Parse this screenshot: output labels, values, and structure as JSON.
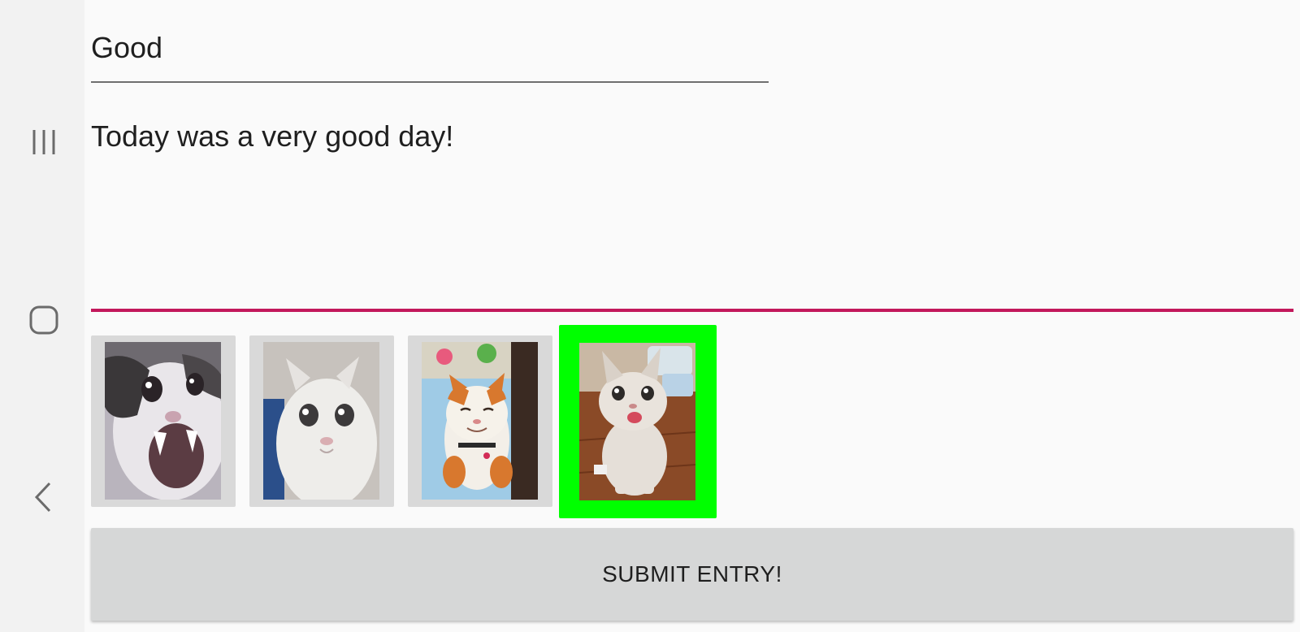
{
  "navigation": {
    "recents_icon": "recents-icon",
    "home_icon": "home-icon",
    "back_icon": "back-icon"
  },
  "entry": {
    "title_value": "Good",
    "body_value": "Today was a very good day!"
  },
  "mood_images": [
    {
      "label": "crying screaming cat",
      "selected": false
    },
    {
      "label": "crying white cat",
      "selected": false
    },
    {
      "label": "smiling orange cat on bed",
      "selected": false
    },
    {
      "label": "happy grey cat on wooden floor",
      "selected": true
    }
  ],
  "submit": {
    "label": "SUBMIT ENTRY!"
  },
  "colors": {
    "accent_underline": "#c2185b",
    "selected_border": "#00ff00",
    "button_bg": "#d6d7d7"
  }
}
